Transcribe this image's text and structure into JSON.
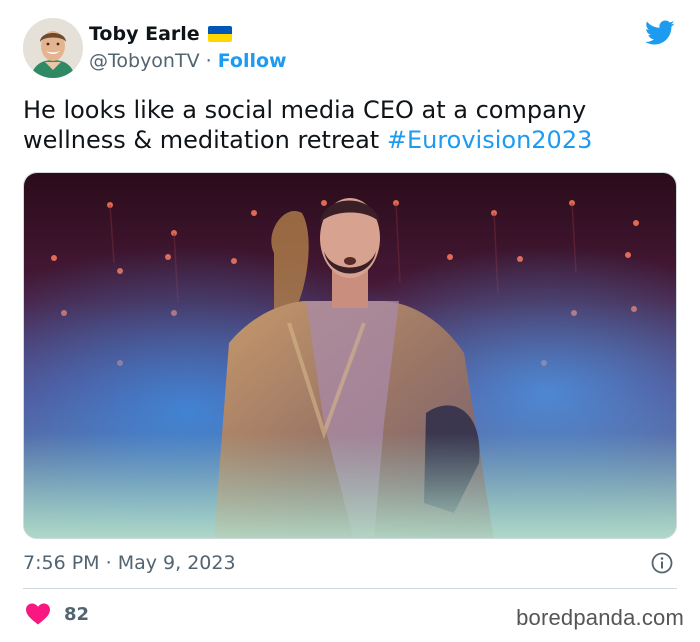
{
  "author": {
    "display_name": "Toby Earle",
    "handle": "@TobyonTV",
    "separator": "·",
    "follow_label": "Follow",
    "flag_icon": "ukraine-flag-icon",
    "avatar_icon": "profile-photo"
  },
  "tweet": {
    "text": "He looks like a social media CEO at a company wellness & meditation retreat",
    "hashtag": "#Eurovision2023",
    "media_icon": "stage-performer-photo"
  },
  "meta": {
    "time": "7:56 PM",
    "separator": "·",
    "date": "May 9, 2023",
    "info_icon": "info-icon"
  },
  "engagement": {
    "likes": "82",
    "heart_icon": "heart-icon"
  },
  "watermark": "boredpanda.com",
  "colors": {
    "link": "#1d9bf0",
    "text": "#0f1419",
    "muted": "#536471",
    "heart": "#f91880"
  }
}
